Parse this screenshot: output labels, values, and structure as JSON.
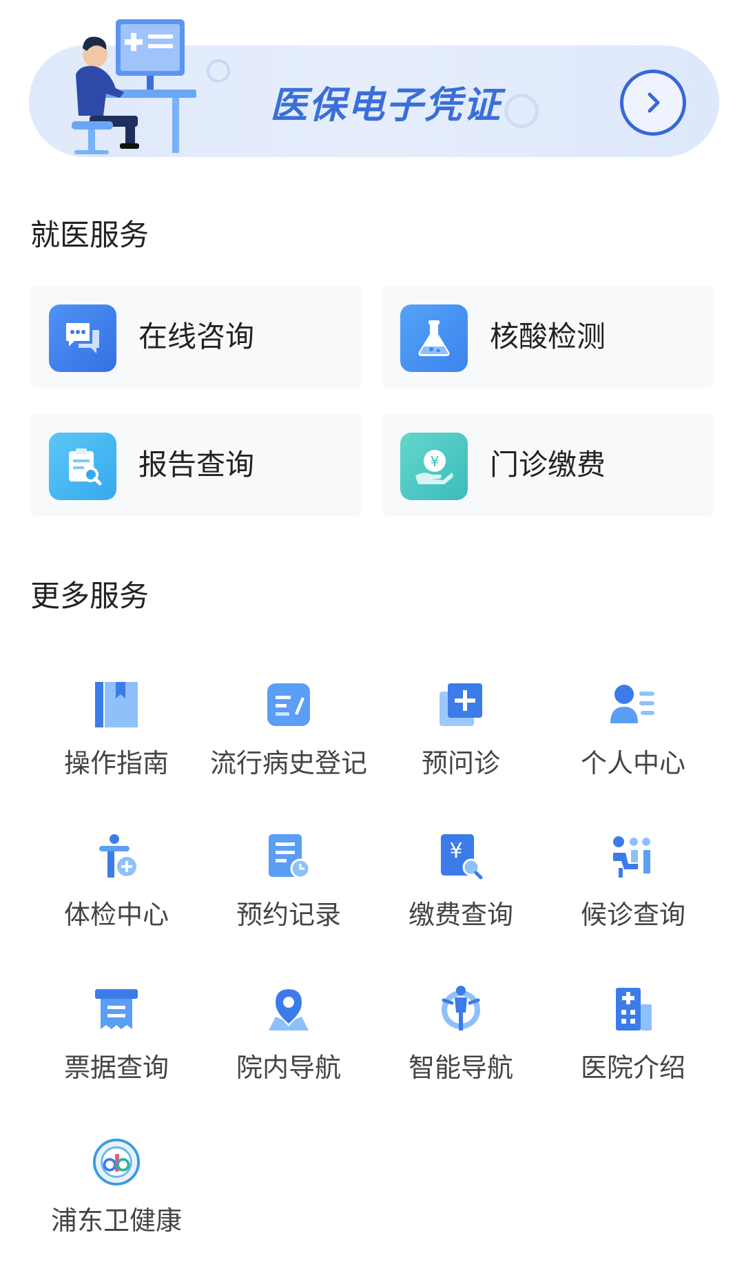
{
  "banner": {
    "title": "医保电子凭证"
  },
  "sections": {
    "medical": "就医服务",
    "more": "更多服务"
  },
  "cards": [
    {
      "label": "在线咨询",
      "icon": "chat-icon",
      "color": "#3b7bea"
    },
    {
      "label": "核酸检测",
      "icon": "flask-icon",
      "color": "#3b8ef0"
    },
    {
      "label": "报告查询",
      "icon": "report-search-icon",
      "color": "#36b4f0"
    },
    {
      "label": "门诊缴费",
      "icon": "payment-icon",
      "color": "#42c8c4"
    }
  ],
  "grid": [
    {
      "label": "操作指南",
      "icon": "guide-book-icon"
    },
    {
      "label": "流行病史登记",
      "icon": "register-form-icon"
    },
    {
      "label": "预问诊",
      "icon": "pre-consult-icon"
    },
    {
      "label": "个人中心",
      "icon": "user-profile-icon"
    },
    {
      "label": "体检中心",
      "icon": "checkup-icon"
    },
    {
      "label": "预约记录",
      "icon": "appointment-record-icon"
    },
    {
      "label": "缴费查询",
      "icon": "payment-search-icon"
    },
    {
      "label": "候诊查询",
      "icon": "waiting-query-icon"
    },
    {
      "label": "票据查询",
      "icon": "receipt-icon"
    },
    {
      "label": "院内导航",
      "icon": "map-pin-icon"
    },
    {
      "label": "智能导航",
      "icon": "smart-navigation-icon"
    },
    {
      "label": "医院介绍",
      "icon": "hospital-building-icon"
    },
    {
      "label": "浦东卫健康",
      "icon": "pudong-health-logo-icon"
    }
  ]
}
